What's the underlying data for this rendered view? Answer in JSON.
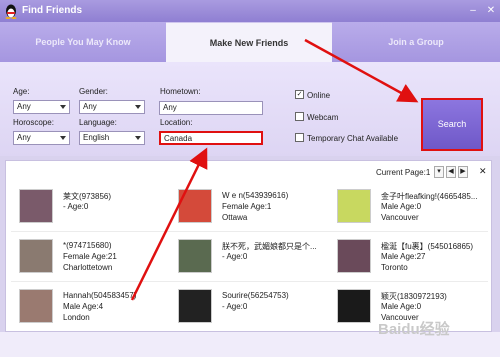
{
  "window": {
    "title": "Find Friends",
    "minimize": "–",
    "close": "✕"
  },
  "tabs": [
    {
      "label": "People You May Know"
    },
    {
      "label": "Make New Friends"
    },
    {
      "label": "Join a Group"
    }
  ],
  "form": {
    "age": {
      "label": "Age:",
      "value": "Any"
    },
    "gender": {
      "label": "Gender:",
      "value": "Any"
    },
    "horoscope": {
      "label": "Horoscope:",
      "value": "Any"
    },
    "language": {
      "label": "Language:",
      "value": "English"
    },
    "hometown": {
      "label": "Hometown:",
      "value": "Any"
    },
    "location": {
      "label": "Location:",
      "value": "Canada"
    },
    "online": {
      "label": "Online",
      "checked": true
    },
    "webcam": {
      "label": "Webcam",
      "checked": false
    },
    "temp_chat": {
      "label": "Temporary Chat Available",
      "checked": false
    },
    "search_label": "Search"
  },
  "results": {
    "current_page_label": "Current Page:",
    "current_page": "1",
    "close": "✕",
    "users": [
      {
        "name": "莱文(973856)",
        "line2": "- Age:0",
        "line3": "",
        "avatar_color": "#7a5a6a"
      },
      {
        "name": "W e n(543939616)",
        "line2": "Female Age:1",
        "line3": "Ottawa",
        "avatar_color": "#d44a3a"
      },
      {
        "name": "金子叶fleafking!(4665485...",
        "line2": "Male Age:0",
        "line3": "Vancouver",
        "avatar_color": "#c8d860"
      },
      {
        "name": "*(974715680)",
        "line2": "Female Age:21",
        "line3": "Charlottetown",
        "avatar_color": "#8a7a70"
      },
      {
        "name": "朕不死，武媚娘都只是个...",
        "line2": "- Age:0",
        "line3": "",
        "avatar_color": "#5a6a50"
      },
      {
        "name": "楹涎【fu裹】(545016865)",
        "line2": "Male Age:27",
        "line3": "Toronto",
        "avatar_color": "#6a4a5a"
      },
      {
        "name": "Hannah(504583457)",
        "line2": "Male Age:4",
        "line3": "London",
        "avatar_color": "#9a7a70"
      },
      {
        "name": "Sourire(56254753)",
        "line2": "- Age:0",
        "line3": "",
        "avatar_color": "#222222"
      },
      {
        "name": "颖灭(1830972193)",
        "line2": "Male Age:0",
        "line3": "Vancouver",
        "avatar_color": "#1a1a1a"
      }
    ]
  },
  "watermark": "Baidu经验"
}
